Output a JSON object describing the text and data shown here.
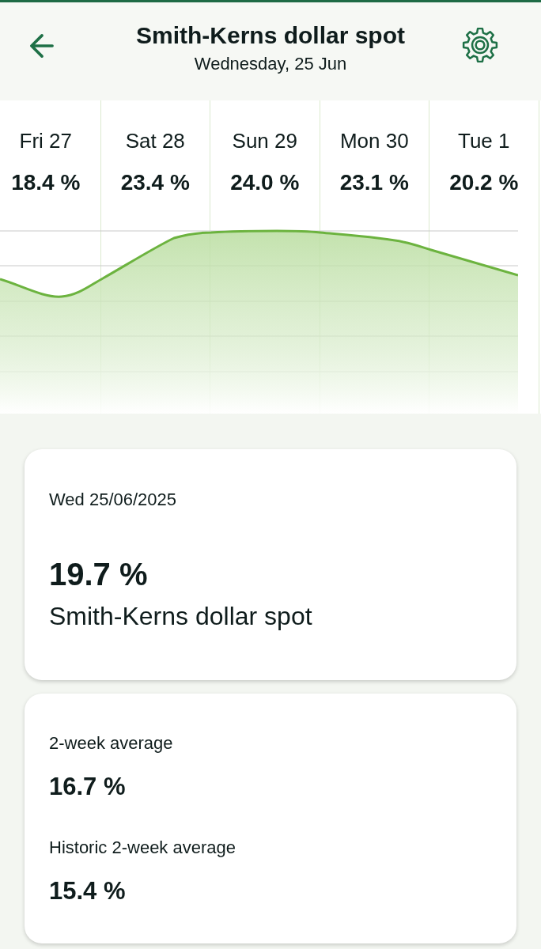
{
  "header": {
    "title": "Smith-Kerns dollar spot",
    "subtitle": "Wednesday, 25 Jun"
  },
  "forecast": {
    "days": [
      {
        "label": "Fri 27",
        "value": "18.4 %"
      },
      {
        "label": "Sat 28",
        "value": "23.4 %"
      },
      {
        "label": "Sun 29",
        "value": "24.0 %"
      },
      {
        "label": "Mon 30",
        "value": "23.1 %"
      },
      {
        "label": "Tue 1",
        "value": "20.2 %"
      }
    ]
  },
  "current": {
    "date": "Wed 25/06/2025",
    "value": "19.7 %",
    "name": "Smith-Kerns dollar spot"
  },
  "averages": [
    {
      "label": "2-week average",
      "value": "16.7 %"
    },
    {
      "label": "Historic 2-week average",
      "value": "15.4 %"
    }
  ]
}
